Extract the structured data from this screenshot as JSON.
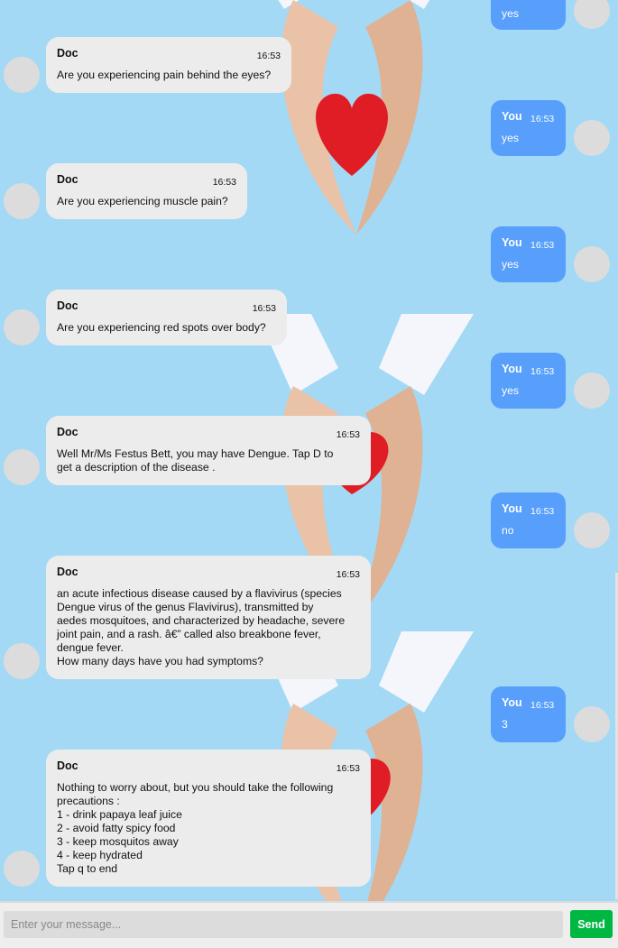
{
  "messages": [
    {
      "sender": "You",
      "time": "",
      "text": "yes"
    },
    {
      "sender": "Doc",
      "time": "16:53",
      "text": "Are you experiencing pain behind the eyes?"
    },
    {
      "sender": "You",
      "time": "16:53",
      "text": "yes"
    },
    {
      "sender": "Doc",
      "time": "16:53",
      "text": "Are you experiencing muscle pain?"
    },
    {
      "sender": "You",
      "time": "16:53",
      "text": "yes"
    },
    {
      "sender": "Doc",
      "time": "16:53",
      "text": "Are you experiencing red spots over body?"
    },
    {
      "sender": "You",
      "time": "16:53",
      "text": "yes"
    },
    {
      "sender": "Doc",
      "time": "16:53",
      "text": "Well Mr/Ms Festus Bett, you may have Dengue. Tap D to\nget a description of the disease ."
    },
    {
      "sender": "You",
      "time": "16:53",
      "text": "no"
    },
    {
      "sender": "Doc",
      "time": "16:53",
      "text": "an acute infectious disease caused by a flavivirus (species\nDengue virus of the genus Flavivirus), transmitted by\naedes mosquitoes, and characterized by headache, severe\njoint pain, and a rash. â€” called also breakbone fever,\ndengue fever.\nHow many days have you had symptoms?"
    },
    {
      "sender": "You",
      "time": "16:53",
      "text": "3"
    },
    {
      "sender": "Doc",
      "time": "16:53",
      "text": "Nothing to worry about, but you should take the following\nprecautions :\n1 - drink papaya leaf juice\n2 - avoid fatty spicy food\n3 - keep mosquitos away\n4 - keep hydrated\nTap q to end"
    }
  ],
  "composer": {
    "placeholder": "Enter your message...",
    "send_label": "Send"
  },
  "colors": {
    "background": "#a3d9f5",
    "doc_bubble": "#ececec",
    "user_bubble": "#579ffb",
    "send_button": "#00b741"
  },
  "icons": {
    "avatar": "avatar-placeholder-circle",
    "background_art": "hands-holding-heart-illustration"
  }
}
